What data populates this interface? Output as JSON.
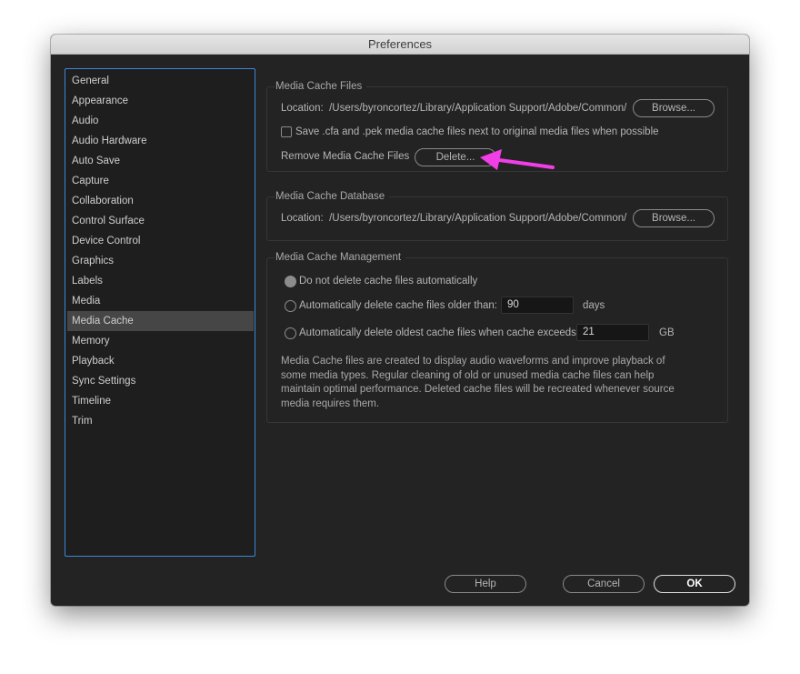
{
  "window": {
    "title": "Preferences"
  },
  "sidebar": {
    "selected": "Media Cache",
    "items": [
      {
        "label": "General"
      },
      {
        "label": "Appearance"
      },
      {
        "label": "Audio"
      },
      {
        "label": "Audio Hardware"
      },
      {
        "label": "Auto Save"
      },
      {
        "label": "Capture"
      },
      {
        "label": "Collaboration"
      },
      {
        "label": "Control Surface"
      },
      {
        "label": "Device Control"
      },
      {
        "label": "Graphics"
      },
      {
        "label": "Labels"
      },
      {
        "label": "Media"
      },
      {
        "label": "Media Cache"
      },
      {
        "label": "Memory"
      },
      {
        "label": "Playback"
      },
      {
        "label": "Sync Settings"
      },
      {
        "label": "Timeline"
      },
      {
        "label": "Trim"
      }
    ]
  },
  "media_cache_files": {
    "title": "Media Cache Files",
    "location_label": "Location:",
    "location_path": "/Users/byroncortez/Library/Application Support/Adobe/Common/",
    "browse_label": "Browse...",
    "save_checkbox_label": "Save .cfa and .pek media cache files next to original media files when possible",
    "save_checkbox_checked": false,
    "remove_label": "Remove Media Cache Files",
    "delete_label": "Delete..."
  },
  "media_cache_database": {
    "title": "Media Cache Database",
    "location_label": "Location:",
    "location_path": "/Users/byroncortez/Library/Application Support/Adobe/Common/",
    "browse_label": "Browse..."
  },
  "media_cache_management": {
    "title": "Media Cache Management",
    "options": [
      {
        "label": "Do not delete cache files automatically",
        "checked": true
      },
      {
        "label": "Automatically delete cache files older than:",
        "checked": false,
        "value": "90",
        "unit": "days"
      },
      {
        "label": "Automatically delete oldest cache files when cache exceeds:",
        "checked": false,
        "value": "21",
        "unit": "GB"
      }
    ],
    "description": "Media Cache files are created to display audio waveforms and improve playback of some media types.  Regular cleaning of old or unused media cache files can help maintain optimal performance. Deleted cache files will be recreated whenever source media requires them."
  },
  "footer": {
    "help_label": "Help",
    "cancel_label": "Cancel",
    "ok_label": "OK"
  },
  "annotation": {
    "arrow_color": "#f23ee6"
  }
}
